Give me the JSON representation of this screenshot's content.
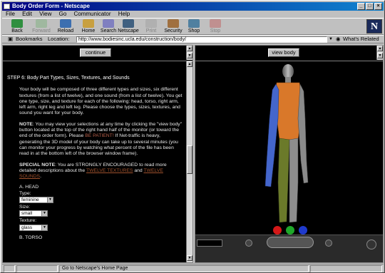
{
  "window": {
    "title": "Body Order Form - Netscape"
  },
  "menu": [
    "File",
    "Edit",
    "View",
    "Go",
    "Communicator",
    "Help"
  ],
  "toolbar": [
    {
      "label": "Back",
      "icon": "back-arrow-icon",
      "enabled": true
    },
    {
      "label": "Forward",
      "icon": "forward-arrow-icon",
      "enabled": false
    },
    {
      "label": "Reload",
      "icon": "reload-icon",
      "enabled": true
    },
    {
      "label": "Home",
      "icon": "home-icon",
      "enabled": true
    },
    {
      "label": "Search",
      "icon": "search-icon",
      "enabled": true
    },
    {
      "label": "Netscape",
      "icon": "netscape-icon",
      "enabled": true
    },
    {
      "label": "Print",
      "icon": "print-icon",
      "enabled": false
    },
    {
      "label": "Security",
      "icon": "security-lock-icon",
      "enabled": true
    },
    {
      "label": "Shop",
      "icon": "shop-icon",
      "enabled": true
    },
    {
      "label": "Stop",
      "icon": "stop-icon",
      "enabled": false
    }
  ],
  "location": {
    "bookmarks_label": "Bookmarks",
    "location_label": "Location:",
    "url": "http://www.bodiesinc.ucla.edu/construction/body/",
    "whats_related": "What's Related"
  },
  "left": {
    "continue_label": "continue",
    "heading": "STEP 6: Body Part Types, Sizes, Textures, and Sounds",
    "para1": "Your body will be composed of three different types and sizes, six different textures (from a list of twelve), and one sound (from a list of twelve). You get one type, size, and texture for each of the following: head, torso, right arm, left arm, right leg and left leg. Please choose the types, sizes, textures, and sound you want for your body.",
    "note_label": "NOTE",
    "note_text_a": ": You may view your selections at any time by clicking the \"view body\" button located at the top of the right hand half of the monitor (or toward the end of the order form). Please ",
    "note_patient": "BE PATIENT!",
    "note_text_b": " If Net-traffic is heavy, generating the 3D model of your body can take up to several minutes (you can monitor your progress by watching what percent of the file has been read in at the bottom left of the browser window frame).",
    "special_label": "SPECIAL NOTE",
    "special_text_a": ": You are STRONGLY ENCOURAGED to read more detailed descriptions about the ",
    "special_link1": "TWELVE TEXTURES",
    "special_and": " and ",
    "special_link2": "TWELVE SOUNDS",
    "special_end": ".",
    "section_head": "A. HEAD",
    "type_label": "Type:",
    "type_value": "feminine",
    "size_label": "Size:",
    "size_value": "small",
    "texture_label": "Texture:",
    "texture_value": "glass",
    "next_section": "B. TORSO"
  },
  "right": {
    "view_body_label": "view body"
  },
  "status": {
    "text": "Go to Netscape's Home Page"
  },
  "colors": {
    "torso": "#d9782a",
    "left_arm": "#4466cc",
    "left_leg": "#6b7a2a",
    "right": "#9a9a9a"
  }
}
